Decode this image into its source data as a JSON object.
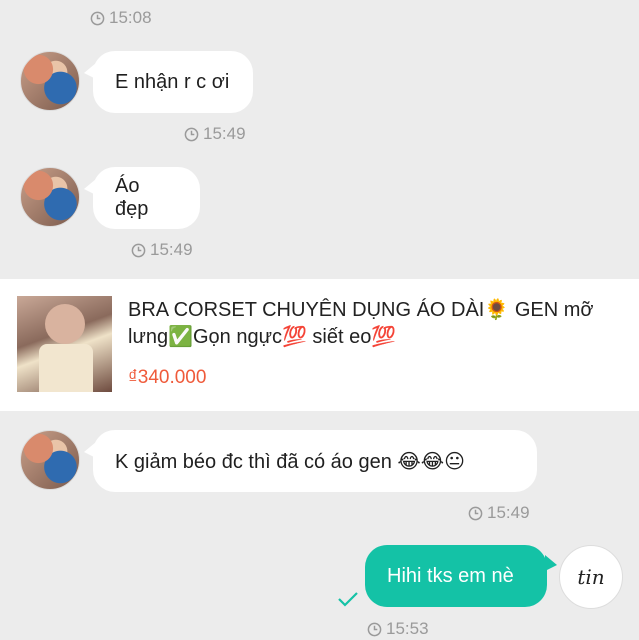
{
  "messages": {
    "t0": "15:08",
    "m1": {
      "text": "E nhận r c ơi",
      "time": "15:49"
    },
    "m2": {
      "text": "Áo đẹp",
      "time": "15:49"
    },
    "product": {
      "title": "BRA CORSET CHUYÊN DỤNG ÁO DÀI🌻 GEN mỡ lưng✅Gọn ngực💯 siết eo💯",
      "price": "₫340.000"
    },
    "m3": {
      "text": "K giảm béo đc thì đã có áo gen 😂😂😐",
      "time": "15:49"
    },
    "m4": {
      "text": "Hihi tks em nè",
      "time": "15:53"
    }
  },
  "store_logo": {
    "text": "tin"
  },
  "colors": {
    "accent": "#14c2a6",
    "price": "#ef5a3a",
    "background": "#ececec"
  },
  "icons": [
    "clock-icon",
    "check-icon"
  ]
}
